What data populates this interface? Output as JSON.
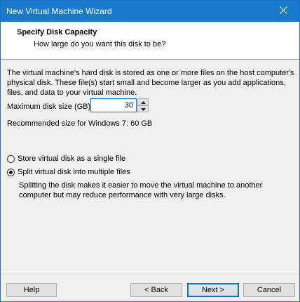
{
  "window": {
    "title": "New Virtual Machine Wizard",
    "close_icon": "close-icon"
  },
  "header": {
    "title": "Specify Disk Capacity",
    "subtitle": "How large do you want this disk to be?"
  },
  "body": {
    "description": "The virtual machine's hard disk is stored as one or more files on the host computer's physical disk. These file(s) start small and become larger as you add applications, files, and data to your virtual machine.",
    "max_size_label": "Maximum disk size (GB):",
    "max_size_value": "30",
    "recommended": "Recommended size for Windows 7: 60 GB",
    "options": {
      "single_label": "Store virtual disk as a single file",
      "split_label": "Split virtual disk into multiple files",
      "selected": "split"
    },
    "split_description": "Splitting the disk makes it easier to move the virtual machine to another computer but may reduce performance with very large disks."
  },
  "buttons": {
    "help": "Help",
    "back": "< Back",
    "next": "Next >",
    "cancel": "Cancel"
  },
  "colors": {
    "titlebar": "#1979ca",
    "focus": "#0078d7"
  }
}
